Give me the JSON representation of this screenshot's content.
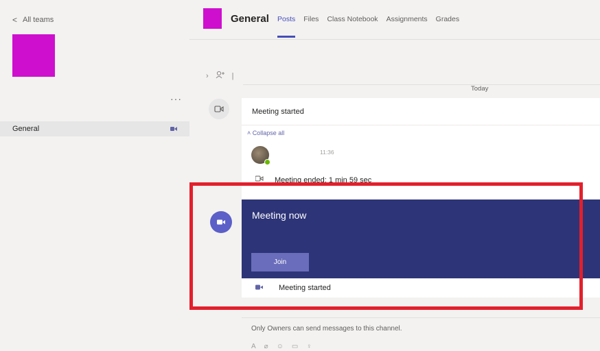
{
  "left": {
    "back_label": "All teams",
    "more": "···",
    "channel_name": "General",
    "team_color": "#cf0fce"
  },
  "header": {
    "channel_title": "General",
    "tabs": [
      "Posts",
      "Files",
      "Class Notebook",
      "Assignments",
      "Grades"
    ],
    "active_tab": "Posts",
    "accent": "#464eb8"
  },
  "feed": {
    "date_label": "Today",
    "thread": {
      "title": "Meeting started",
      "collapse_label": "Collapse all",
      "reply_time": "11:36",
      "ended_text": "Meeting ended: 1 min 59 sec"
    },
    "meeting": {
      "title": "Meeting now",
      "join_label": "Join",
      "footer_text": "Meeting started",
      "card_color": "#2d3477"
    },
    "owners_notice": "Only Owners can send messages to this channel."
  },
  "annotation": {
    "highlight_color": "#e2202c"
  }
}
